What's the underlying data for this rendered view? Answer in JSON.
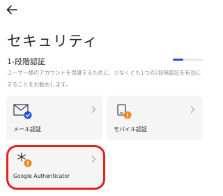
{
  "title": "セキュリティ",
  "level": {
    "label": "1-段階認証",
    "progress": 0.33
  },
  "description": "ユーザー様のアカウントを保護するために、少なくとも1つの2段階認証を有効にすることをお勧めします。",
  "colors": {
    "accent": "#1f4fd8",
    "check_badge": "#1f4fd8",
    "warning_badge": "#f0861e",
    "highlight": "#e8201a",
    "card_bg": "#f5f5f5"
  },
  "methods": [
    {
      "label": "メール認証",
      "icon": "mail-icon",
      "badge": "check-badge-icon"
    },
    {
      "label": "モバイル認証",
      "icon": "phone-icon",
      "badge": "warning-badge-icon"
    },
    {
      "label": "Google Authenticator",
      "icon": "authenticator-icon",
      "badge": "warning-badge-icon"
    }
  ]
}
